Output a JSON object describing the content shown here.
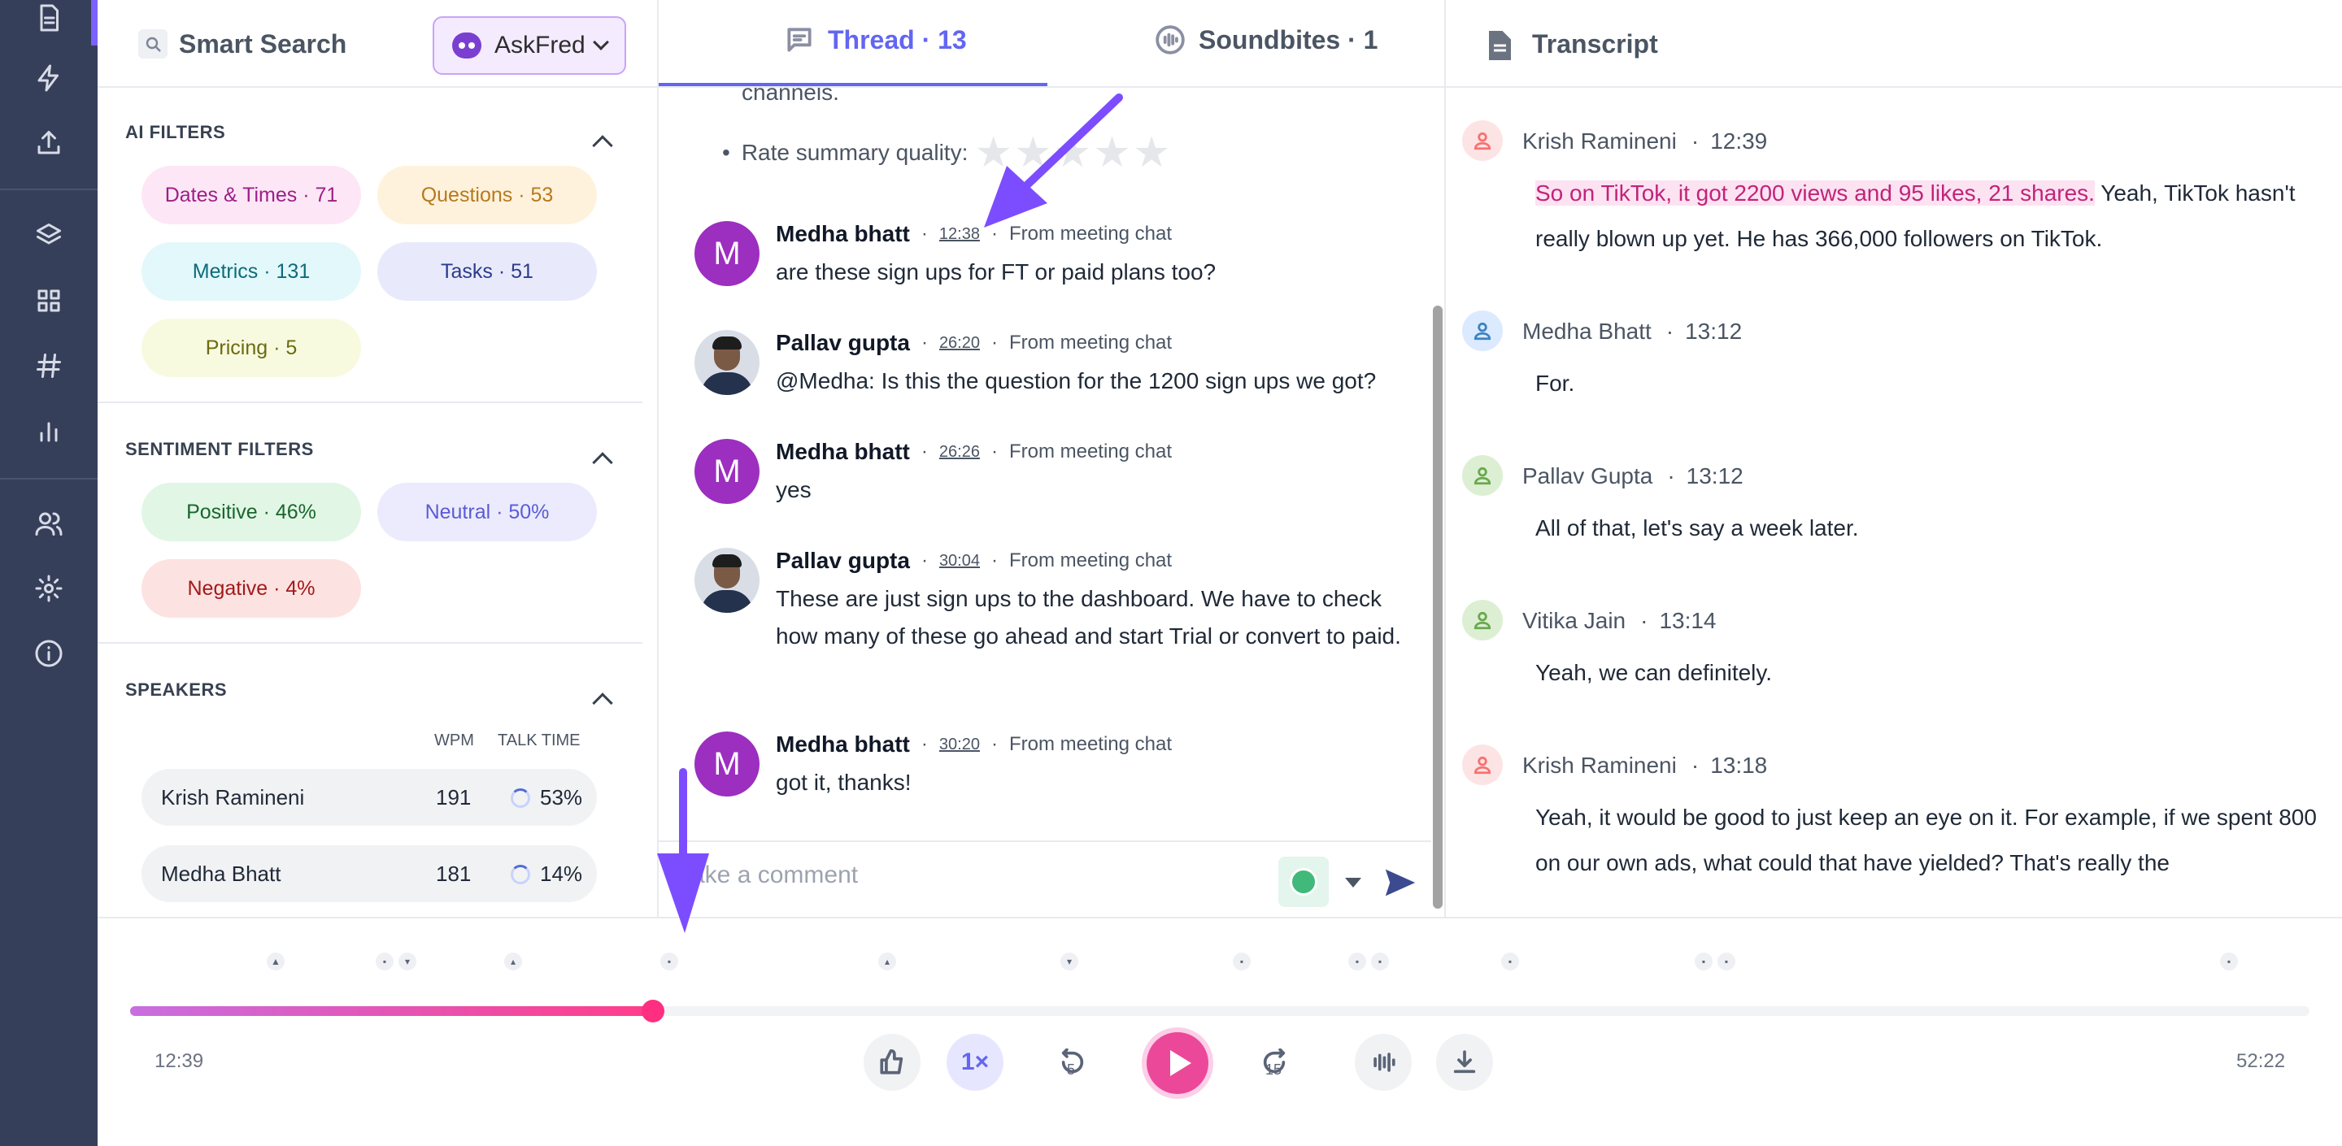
{
  "nav": {
    "items": [
      "document-icon",
      "bolt-icon",
      "upload-icon",
      "layers-icon",
      "grid-icon",
      "hashtag-icon",
      "bar-chart-icon",
      "users-icon",
      "gear-icon",
      "info-icon"
    ],
    "accent_color": "#7b61ff",
    "background_color": "#363f5a"
  },
  "filters": {
    "title": "Smart Search",
    "askfred_label": "AskFred",
    "ai_filters": {
      "title": "AI FILTERS",
      "chips": [
        "Dates & Times · 71",
        "Questions · 53",
        "Metrics · 131",
        "Tasks · 51",
        "Pricing · 5"
      ]
    },
    "sentiment_filters": {
      "title": "SENTIMENT FILTERS",
      "chips": [
        "Positive · 46%",
        "Neutral · 50%",
        "Negative · 4%"
      ]
    },
    "speakers": {
      "title": "SPEAKERS",
      "col_wpm": "WPM",
      "col_talk": "TALK TIME",
      "rows": [
        {
          "name": "Krish Ramineni",
          "wpm": "191",
          "talk": "53%"
        },
        {
          "name": "Medha Bhatt",
          "wpm": "181",
          "talk": "14%"
        }
      ]
    }
  },
  "thread": {
    "tab_thread": "Thread · 13",
    "tab_soundbites": "Soundbites · 1",
    "top_text": "channels.",
    "rate_label": "Rate summary quality:",
    "stars": "★★★★★",
    "messages": [
      {
        "initial": "M",
        "name": "Medha bhatt",
        "time": "12:38",
        "source": "From meeting chat",
        "text": "are these sign ups for FT or paid plans too?"
      },
      {
        "initial": "",
        "name": "Pallav gupta",
        "time": "26:20",
        "source": "From meeting chat",
        "text": "@Medha: Is this the question for the 1200 sign ups we got?"
      },
      {
        "initial": "M",
        "name": "Medha bhatt",
        "time": "26:26",
        "source": "From meeting chat",
        "text": "yes"
      },
      {
        "initial": "",
        "name": "Pallav gupta",
        "time": "30:04",
        "source": "From meeting chat",
        "text": "These are just sign ups to the dashboard. We have to check how many of these go ahead and start Trial or convert to paid."
      },
      {
        "initial": "M",
        "name": "Medha bhatt",
        "time": "30:20",
        "source": "From meeting chat",
        "text": "got it, thanks!"
      }
    ],
    "comment_placeholder": "ake a comment"
  },
  "transcript": {
    "title": "Transcript",
    "segments": [
      {
        "speaker": "Krish Ramineni",
        "time": "12:39",
        "highlight": "So on TikTok, it got 2200 views and 95 likes, 21 shares.",
        "text": " Yeah, TikTok hasn't really blown up yet. He has 366,000 followers on TikTok.",
        "color": "#f87171",
        "bg": "#fde4e4"
      },
      {
        "speaker": "Medha Bhatt",
        "time": "13:12",
        "highlight": "",
        "text": "For.",
        "color": "#3b82c4",
        "bg": "#dbeafe"
      },
      {
        "speaker": "Pallav Gupta",
        "time": "13:12",
        "highlight": "",
        "text": "All of that, let's say a week later.",
        "color": "#6aa84f",
        "bg": "#dcefd3"
      },
      {
        "speaker": "Vitika Jain",
        "time": "13:14",
        "highlight": "",
        "text": "Yeah, we can definitely.",
        "color": "#6aa84f",
        "bg": "#dcefd3"
      },
      {
        "speaker": "Krish Ramineni",
        "time": "13:18",
        "highlight": "",
        "text": "Yeah, it would be good to just keep an eye on it. For example, if we spent 800 on our own ads, what could that have yielded? That's really the",
        "color": "#f87171",
        "bg": "#fde4e4"
      }
    ]
  },
  "player": {
    "current_time": "12:39",
    "total_time": "52:22",
    "progress": 0.24,
    "speed": "1×",
    "skip_back": "5",
    "skip_forward": "15",
    "markers": [
      "pin-icon",
      "chat-icon",
      "thumbs-up-icon",
      "chat-icon",
      "thumbs-up-icon",
      "thumbs-down-icon",
      "chat-icon",
      "chat-icon",
      "chat-icon",
      "chat-icon",
      "chat-icon"
    ]
  },
  "annotation": {
    "arrow_color": "#7c4dff"
  }
}
